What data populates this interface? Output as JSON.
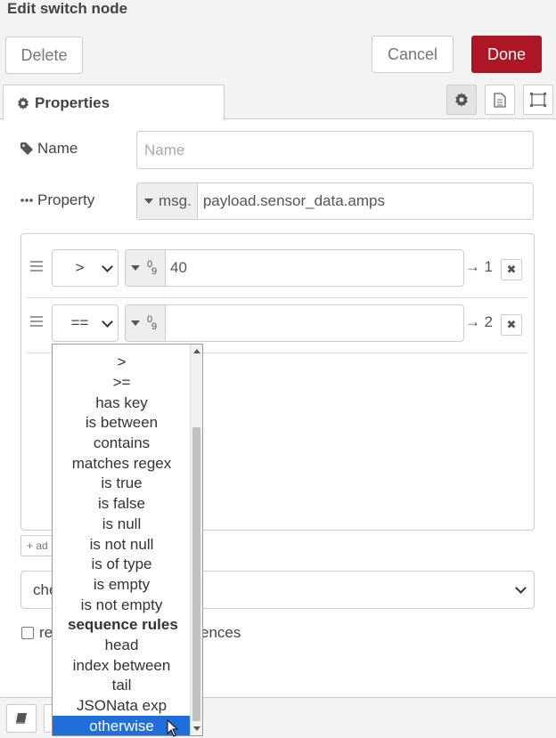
{
  "header": {
    "title": "Edit switch node"
  },
  "toolbar": {
    "delete_label": "Delete",
    "cancel_label": "Cancel",
    "done_label": "Done"
  },
  "tabs": {
    "properties_label": "Properties"
  },
  "form": {
    "name_label": "Name",
    "name_placeholder": "Name",
    "property_label": "Property",
    "property_type": "msg.",
    "property_value": "payload.sensor_data.amps"
  },
  "rules": [
    {
      "operator": ">",
      "value": "40",
      "output": "→ 1",
      "remove": "✖"
    },
    {
      "operator": "==",
      "value": "",
      "output": "→ 2",
      "remove": "✖"
    }
  ],
  "add_label": "+ ad",
  "check_select_value": "che",
  "recompute_label": "re",
  "recompute_label_tail": "ences",
  "operator_dropdown": {
    "items": [
      {
        "label": ">",
        "type": "option"
      },
      {
        "label": ">=",
        "type": "option"
      },
      {
        "label": "has key",
        "type": "option"
      },
      {
        "label": "is between",
        "type": "option"
      },
      {
        "label": "contains",
        "type": "option"
      },
      {
        "label": "matches regex",
        "type": "option"
      },
      {
        "label": "is true",
        "type": "option"
      },
      {
        "label": "is false",
        "type": "option"
      },
      {
        "label": "is null",
        "type": "option"
      },
      {
        "label": "is not null",
        "type": "option"
      },
      {
        "label": "is of type",
        "type": "option"
      },
      {
        "label": "is empty",
        "type": "option"
      },
      {
        "label": "is not empty",
        "type": "option"
      },
      {
        "label": "sequence rules",
        "type": "group"
      },
      {
        "label": "head",
        "type": "option"
      },
      {
        "label": "index between",
        "type": "option"
      },
      {
        "label": "tail",
        "type": "option"
      },
      {
        "label": "JSONata exp",
        "type": "option"
      },
      {
        "label": "otherwise",
        "type": "selected"
      }
    ]
  },
  "colors": {
    "done": "#ad1625",
    "selected": "#1e6fd9"
  }
}
